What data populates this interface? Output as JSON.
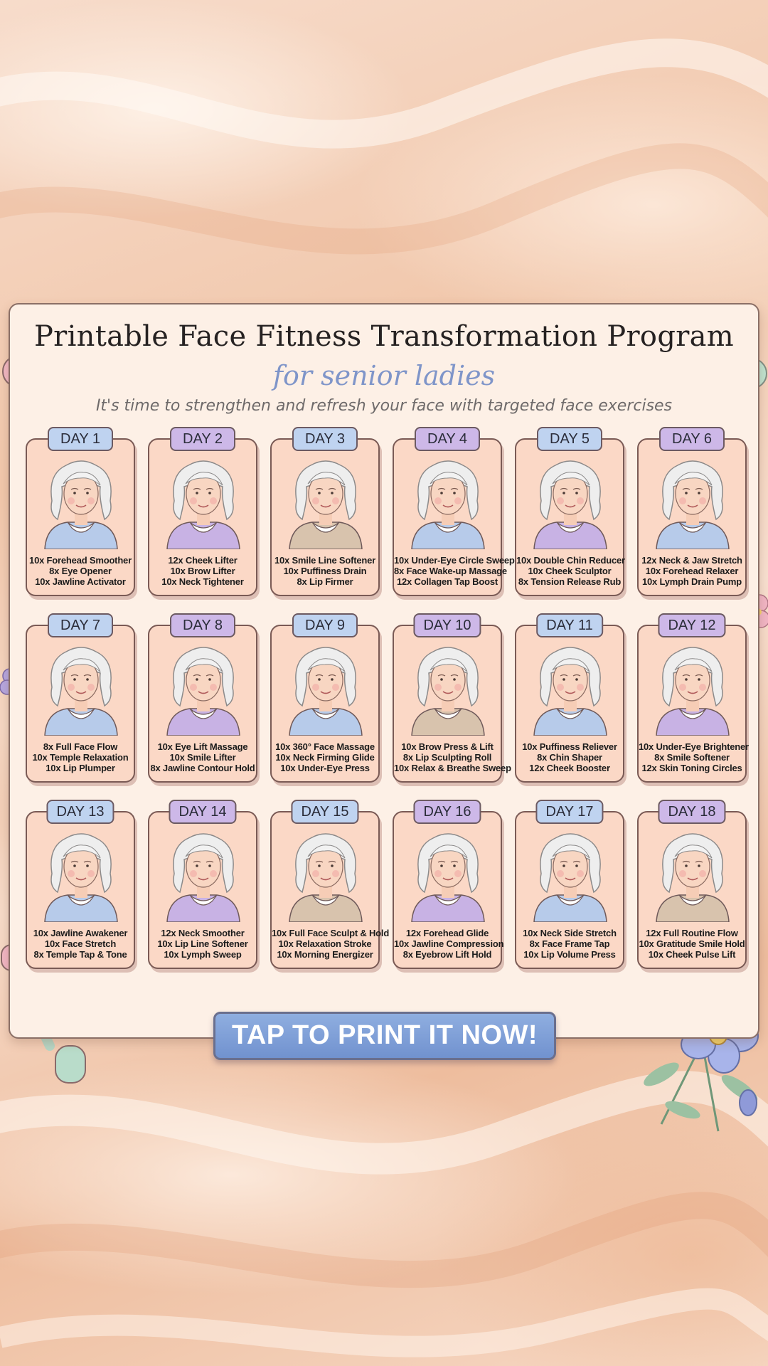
{
  "header": {
    "title": "Printable Face Fitness Transformation Program",
    "subtitle": "for senior ladies",
    "tagline": "It's time to strengthen and refresh your face with targeted face exercises"
  },
  "days": [
    {
      "label": "DAY 1",
      "badge_color": "#bfd3f0",
      "shirt_color": "#b7cbea",
      "exercises": [
        "10x Forehead Smoother",
        "8x Eye Opener",
        "10x Jawline Activator"
      ]
    },
    {
      "label": "DAY 2",
      "badge_color": "#cdb8e8",
      "shirt_color": "#c8b2e4",
      "exercises": [
        "12x Cheek Lifter",
        "10x Brow Lifter",
        "10x Neck Tightener"
      ]
    },
    {
      "label": "DAY 3",
      "badge_color": "#bfd3f0",
      "shirt_color": "#d8c3ad",
      "exercises": [
        "10x Smile Line Softener",
        "10x Puffiness Drain",
        "8x Lip Firmer"
      ]
    },
    {
      "label": "DAY 4",
      "badge_color": "#cdb8e8",
      "shirt_color": "#b7cbea",
      "exercises": [
        "10x Under-Eye Circle Sweep",
        "8x Face Wake-up Massage",
        "12x Collagen Tap Boost"
      ]
    },
    {
      "label": "DAY 5",
      "badge_color": "#bfd3f0",
      "shirt_color": "#c8b2e4",
      "exercises": [
        "10x Double Chin Reducer",
        "10x Cheek Sculptor",
        "8x Tension Release Rub"
      ]
    },
    {
      "label": "DAY 6",
      "badge_color": "#cdb8e8",
      "shirt_color": "#b7cbea",
      "exercises": [
        "12x Neck & Jaw Stretch",
        "10x Forehead Relaxer",
        "10x Lymph Drain Pump"
      ]
    },
    {
      "label": "DAY 7",
      "badge_color": "#bfd3f0",
      "shirt_color": "#b7cbea",
      "exercises": [
        "8x Full Face Flow",
        "10x Temple Relaxation",
        "10x Lip Plumper"
      ]
    },
    {
      "label": "DAY 8",
      "badge_color": "#cdb8e8",
      "shirt_color": "#c8b2e4",
      "exercises": [
        "10x Eye Lift Massage",
        "10x Smile Lifter",
        "8x Jawline Contour Hold"
      ]
    },
    {
      "label": "DAY 9",
      "badge_color": "#bfd3f0",
      "shirt_color": "#b7cbea",
      "exercises": [
        "10x 360° Face Massage",
        "10x Neck Firming Glide",
        "10x Under-Eye Press"
      ]
    },
    {
      "label": "DAY 10",
      "badge_color": "#cdb8e8",
      "shirt_color": "#d8c3ad",
      "exercises": [
        "10x Brow Press & Lift",
        "8x Lip Sculpting Roll",
        "10x Relax & Breathe Sweep"
      ]
    },
    {
      "label": "DAY 11",
      "badge_color": "#bfd3f0",
      "shirt_color": "#b7cbea",
      "exercises": [
        "10x Puffiness Reliever",
        "8x Chin Shaper",
        "12x Cheek Booster"
      ]
    },
    {
      "label": "DAY 12",
      "badge_color": "#cdb8e8",
      "shirt_color": "#c8b2e4",
      "exercises": [
        "10x Under-Eye Brightener",
        "8x Smile Softener",
        "12x Skin Toning Circles"
      ]
    },
    {
      "label": "DAY 13",
      "badge_color": "#bfd3f0",
      "shirt_color": "#b7cbea",
      "exercises": [
        "10x Jawline Awakener",
        "10x Face Stretch",
        "8x Temple Tap & Tone"
      ]
    },
    {
      "label": "DAY 14",
      "badge_color": "#cdb8e8",
      "shirt_color": "#c8b2e4",
      "exercises": [
        "12x Neck Smoother",
        "10x Lip Line Softener",
        "10x Lymph Sweep"
      ]
    },
    {
      "label": "DAY 15",
      "badge_color": "#bfd3f0",
      "shirt_color": "#d8c3ad",
      "exercises": [
        "10x Full Face Sculpt & Hold",
        "10x Relaxation Stroke",
        "10x Morning Energizer"
      ]
    },
    {
      "label": "DAY 16",
      "badge_color": "#cdb8e8",
      "shirt_color": "#c8b2e4",
      "exercises": [
        "12x Forehead Glide",
        "10x Jawline Compression",
        "8x Eyebrow Lift Hold"
      ]
    },
    {
      "label": "DAY 17",
      "badge_color": "#bfd3f0",
      "shirt_color": "#b7cbea",
      "exercises": [
        "10x Neck Side Stretch",
        "8x Face Frame Tap",
        "10x Lip Volume Press"
      ]
    },
    {
      "label": "DAY 18",
      "badge_color": "#cdb8e8",
      "shirt_color": "#d8c3ad",
      "exercises": [
        "12x Full Routine Flow",
        "10x Gratitude Smile Hold",
        "10x Cheek Pulse Lift"
      ]
    }
  ],
  "cta": {
    "label": "TAP TO PRINT IT NOW!"
  },
  "icons": {
    "illustration": "senior-woman-face-icon",
    "roller": "jade-face-roller-icon",
    "flower": "flower-icon"
  },
  "colors": {
    "card_bg": "#fdf0e6",
    "tile_bg": "#fbd8c6",
    "subtitle": "#7f95c9",
    "cta_bg": "#7f9fd8"
  }
}
